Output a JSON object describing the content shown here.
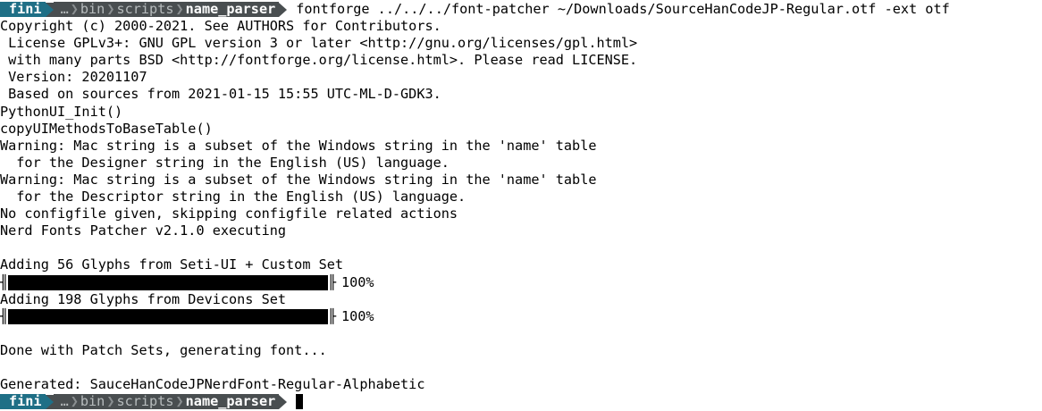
{
  "prompt": {
    "user": "fini",
    "ellipsis": "…",
    "path": [
      "bin",
      "scripts"
    ],
    "current_dir": "name_parser",
    "separator": "❯"
  },
  "command": "fontforge ../../../font-patcher ~/Downloads/SourceHanCodeJP-Regular.otf -ext otf",
  "output_lines_1": [
    "Copyright (c) 2000-2021. See AUTHORS for Contributors.",
    " License GPLv3+: GNU GPL version 3 or later <http://gnu.org/licenses/gpl.html>",
    " with many parts BSD <http://fontforge.org/license.html>. Please read LICENSE.",
    " Version: 20201107",
    " Based on sources from 2021-01-15 15:55 UTC-ML-D-GDK3.",
    "PythonUI_Init()",
    "copyUIMethodsToBaseTable()",
    "Warning: Mac string is a subset of the Windows string in the 'name' table",
    "  for the Designer string in the English (US) language.",
    "Warning: Mac string is a subset of the Windows string in the 'name' table",
    "  for the Descriptor string in the English (US) language.",
    "No configfile given, skipping configfile related actions",
    "Nerd Fonts Patcher v2.1.0 executing",
    ""
  ],
  "progress": [
    {
      "label": "Adding 56 Glyphs from Seti-UI + Custom Set",
      "percent_text": "100%",
      "fraction": 1.0
    },
    {
      "label": "Adding 198 Glyphs from Devicons Set",
      "percent_text": "100%",
      "fraction": 1.0
    }
  ],
  "output_lines_2": [
    "",
    "Done with Patch Sets, generating font...",
    "",
    "Generated: SauceHanCodeJPNerdFont-Regular-Alphabetic"
  ],
  "colors": {
    "user_segment": "#1f6f86",
    "dir_segment": "#494e50",
    "background": "#ffffff",
    "text": "#000000"
  }
}
